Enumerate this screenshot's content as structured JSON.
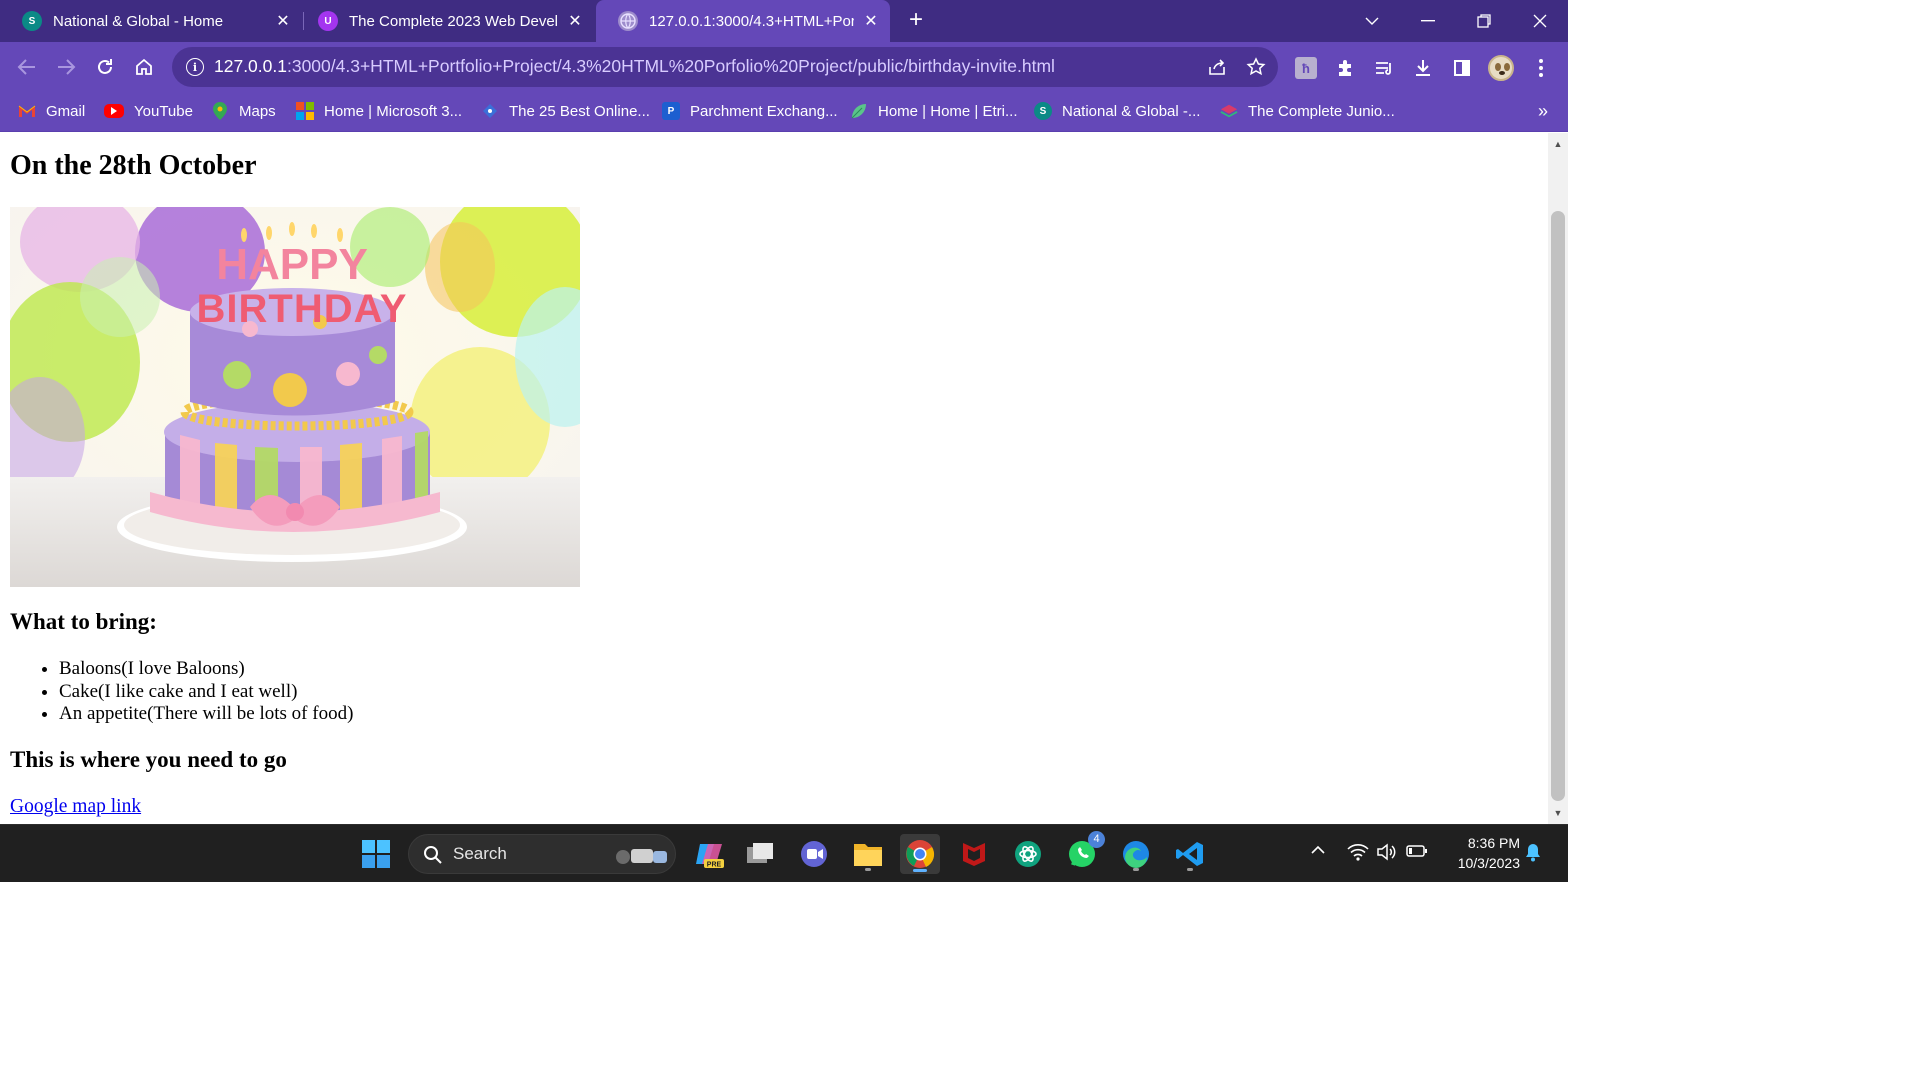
{
  "browser": {
    "tabs": [
      {
        "title": "National & Global - Home",
        "active": false
      },
      {
        "title": "The Complete 2023 Web Develo",
        "active": false
      },
      {
        "title": "127.0.0.1:3000/4.3+HTML+Portf",
        "active": true
      }
    ],
    "url_host": "127.0.0.1",
    "url_rest": ":3000/4.3+HTML+Portfolio+Project/4.3%20HTML%20Porfolio%20Project/public/birthday-invite.html",
    "bookmarks": [
      {
        "label": "Gmail"
      },
      {
        "label": "YouTube"
      },
      {
        "label": "Maps"
      },
      {
        "label": "Home | Microsoft 3..."
      },
      {
        "label": "The 25 Best Online..."
      },
      {
        "label": "Parchment Exchang..."
      },
      {
        "label": "Home | Home | Etri..."
      },
      {
        "label": "National & Global -..."
      },
      {
        "label": "The Complete Junio..."
      }
    ],
    "colors": {
      "frame": "#3f2c82",
      "toolbar": "#6448b8",
      "omnibox": "#4b3394"
    }
  },
  "page": {
    "heading": "On the 28th October",
    "cake_text_top": "HAPPY",
    "cake_text_bottom": "BIRTHDAY",
    "bring_heading": "What to bring:",
    "bring_items": [
      "Baloons(I love Baloons)",
      "Cake(I like cake and I eat well)",
      "An appetite(There will be lots of food)"
    ],
    "where_heading": "This is where you need to go",
    "map_link": "Google map link"
  },
  "taskbar": {
    "search_label": "Search",
    "whatsapp_badge": "4",
    "time": "8:36 PM",
    "date": "10/3/2023"
  }
}
